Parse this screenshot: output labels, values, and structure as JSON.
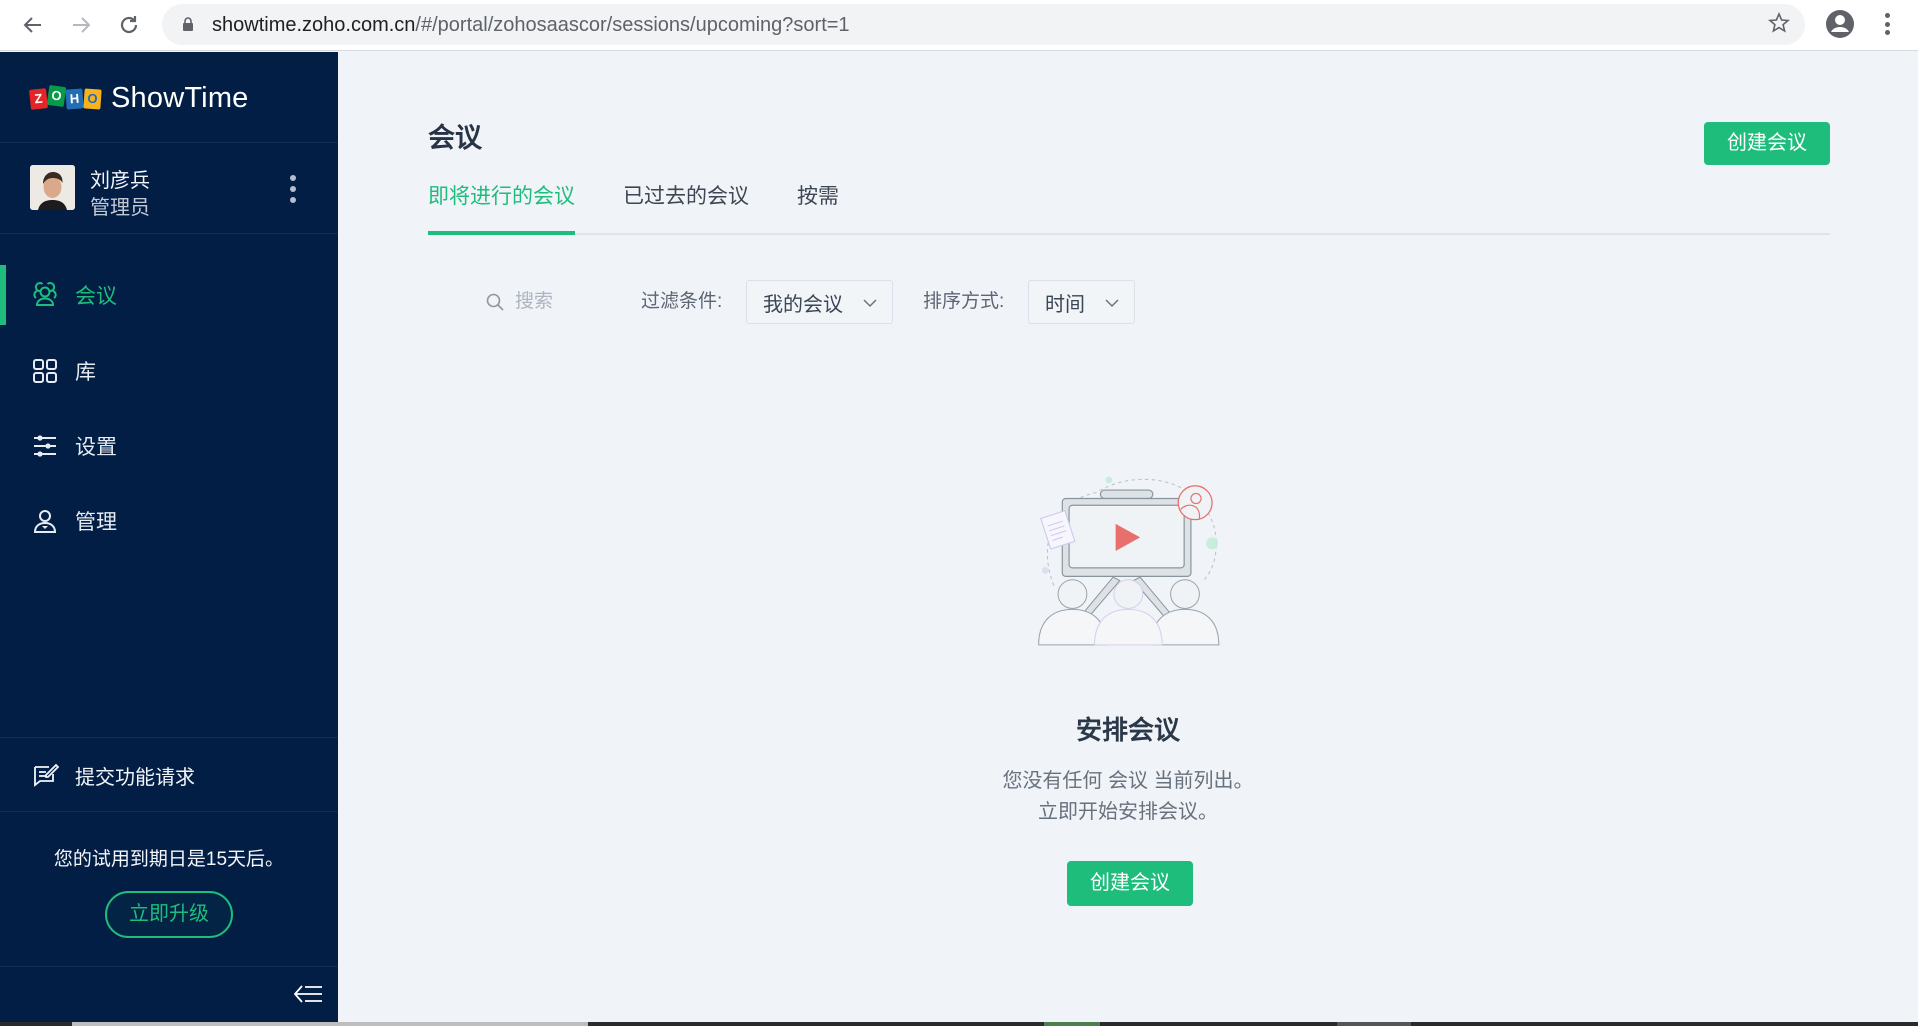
{
  "browser": {
    "url_host": "showtime.zoho.com.cn",
    "url_path": "/#/portal/zohosaascor/sessions/upcoming?sort=1",
    "icons": {
      "back": "arrow-left-icon",
      "forward": "arrow-right-icon",
      "reload": "reload-icon",
      "lock": "lock-icon",
      "bookmark": "star-icon",
      "profile": "account-circle-icon",
      "menu": "more-vert-icon"
    }
  },
  "sidebar": {
    "logo": {
      "brand_letters": [
        "Z",
        "O",
        "H",
        "O"
      ],
      "product": "ShowTime"
    },
    "user": {
      "name": "刘彦兵",
      "role": "管理员"
    },
    "items": [
      {
        "label": "会议",
        "icon": "meetings-icon",
        "active": true
      },
      {
        "label": "库",
        "icon": "library-grid-icon",
        "active": false
      },
      {
        "label": "设置",
        "icon": "settings-sliders-icon",
        "active": false
      },
      {
        "label": "管理",
        "icon": "admin-user-icon",
        "active": false
      }
    ],
    "feature_request": {
      "label": "提交功能请求",
      "icon": "feedback-edit-icon"
    },
    "trial": {
      "message": "您的试用到期日是15天后。",
      "upgrade_label": "立即升级"
    },
    "collapse_icon": "collapse-sidebar-icon"
  },
  "main": {
    "title": "会议",
    "create_button": "创建会议",
    "tabs": [
      {
        "label": "即将进行的会议",
        "active": true
      },
      {
        "label": "已过去的会议",
        "active": false
      },
      {
        "label": "按需",
        "active": false
      }
    ],
    "filters": {
      "search_placeholder": "搜索",
      "filter_label": "过滤条件:",
      "filter_value": "我的会议",
      "sort_label": "排序方式:",
      "sort_value": "时间"
    },
    "empty_state": {
      "title": "安排会议",
      "line1": "您没有任何 会议 当前列出。",
      "line2": "立即开始安排会议。",
      "button": "创建会议"
    }
  },
  "colors": {
    "accent": "#1ebd7c",
    "sidebar_bg": "#021e45",
    "main_bg": "#f0f4f8",
    "play_icon": "#e96f6f"
  }
}
